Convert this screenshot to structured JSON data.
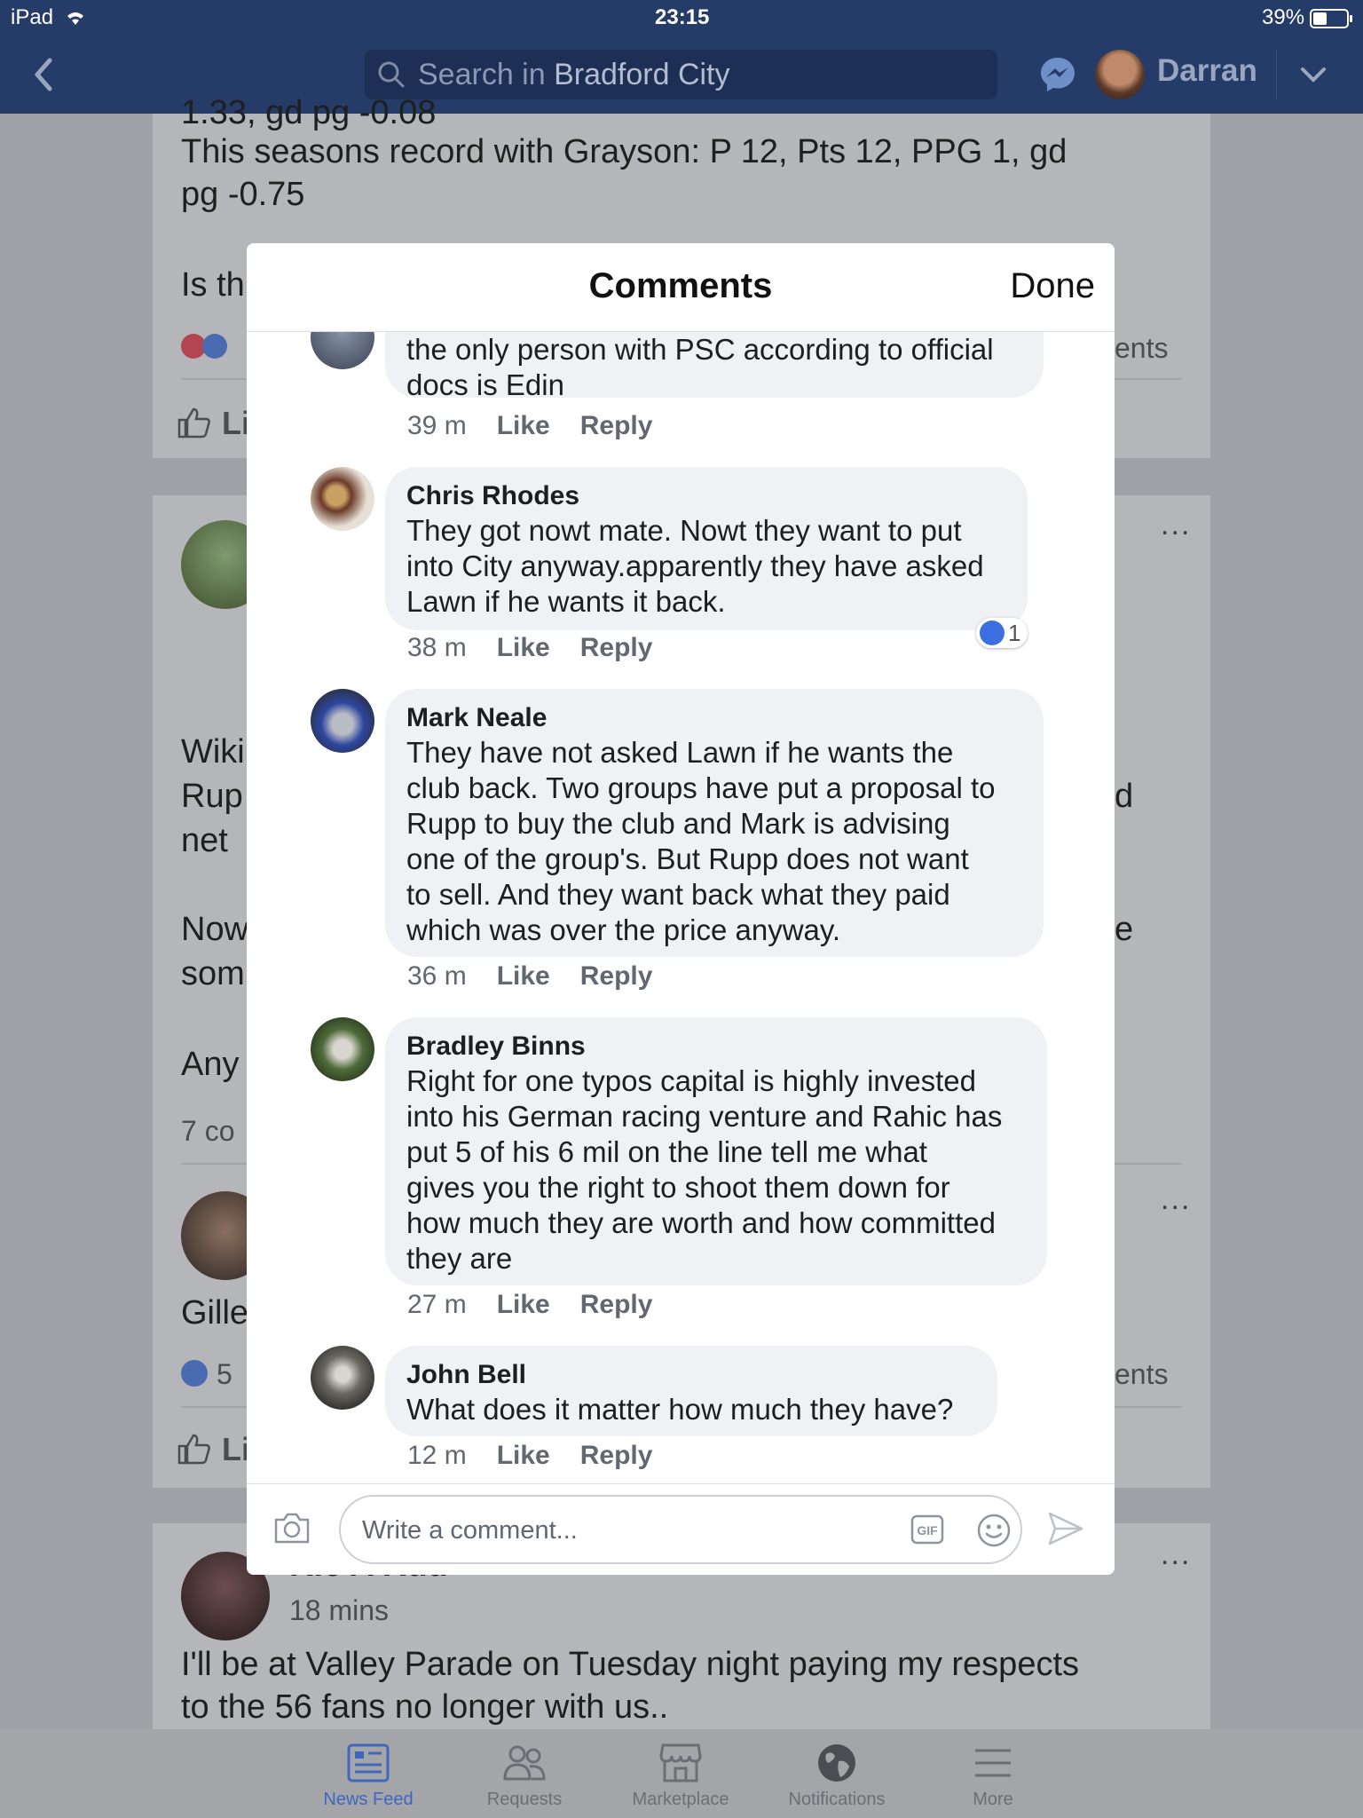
{
  "status": {
    "device": "iPad",
    "time": "23:15",
    "battery": "39%"
  },
  "nav": {
    "search_placeholder": "Search in ",
    "search_group": "Bradford City",
    "user_name": "Darran"
  },
  "feed": {
    "post1_line0": "1.33, gd pg -0.08",
    "post1_line1": "This seasons record with  Grayson:  P 12, Pts 12,  PPG  1, gd",
    "post1_line2": "pg -0.75",
    "post1_line3": "Is th",
    "post1_comments": "ents",
    "like_short": "Li",
    "post2_lines": [
      "Wiki",
      "Rup",
      "net ",
      "Now",
      "som",
      "Any"
    ],
    "post2_right": [
      "d",
      "e"
    ],
    "post2_comments": "7 co",
    "post3_text": "Gille",
    "post3_reactions": "5",
    "post3_comments": "ents",
    "post4_name": "Ric A Rud",
    "post4_time": "18 mins",
    "post4_line1": "I'll be at Valley Parade on Tuesday night paying my respects",
    "post4_line2": "to the 56 fans no longer with us..",
    "more": "..."
  },
  "modal": {
    "title": "Comments",
    "done": "Done",
    "like_label": "Like",
    "reply_label": "Reply",
    "comments": [
      {
        "name": "",
        "text": [
          "the only person with PSC according to official",
          "docs is Edin"
        ],
        "time": "39 m"
      },
      {
        "name": "Chris Rhodes",
        "text": [
          "They got nowt mate. Nowt they want to put",
          "into City anyway.apparently they have asked",
          "Lawn if he wants it back."
        ],
        "time": "38 m",
        "reactions": "1"
      },
      {
        "name": "Mark Neale",
        "text": [
          "They have not asked Lawn if he wants the",
          "club back. Two groups have put a proposal to",
          "Rupp to buy the club and Mark is advising",
          "one of the group's. But Rupp does not want",
          "to sell. And they want back what they paid",
          "which was over the price anyway."
        ],
        "time": "36 m"
      },
      {
        "name": "Bradley Binns",
        "text": [
          "Right for one typos capital is highly invested",
          "into his German racing venture and Rahic has",
          "put 5 of his 6 mil on the line tell me what",
          "gives you the right to shoot them down for",
          "how much they are worth and how committed",
          "they are"
        ],
        "time": "27 m"
      },
      {
        "name": "John Bell",
        "text": [
          "What does it matter how much they have?"
        ],
        "time": "12 m"
      }
    ],
    "composer_placeholder": "Write a comment..."
  },
  "tabs": [
    {
      "label": "News Feed",
      "icon": "news-feed-icon",
      "active": true
    },
    {
      "label": "Requests",
      "icon": "requests-icon"
    },
    {
      "label": "Marketplace",
      "icon": "marketplace-icon"
    },
    {
      "label": "Notifications",
      "icon": "notifications-icon"
    },
    {
      "label": "More",
      "icon": "more-menu-icon"
    }
  ]
}
